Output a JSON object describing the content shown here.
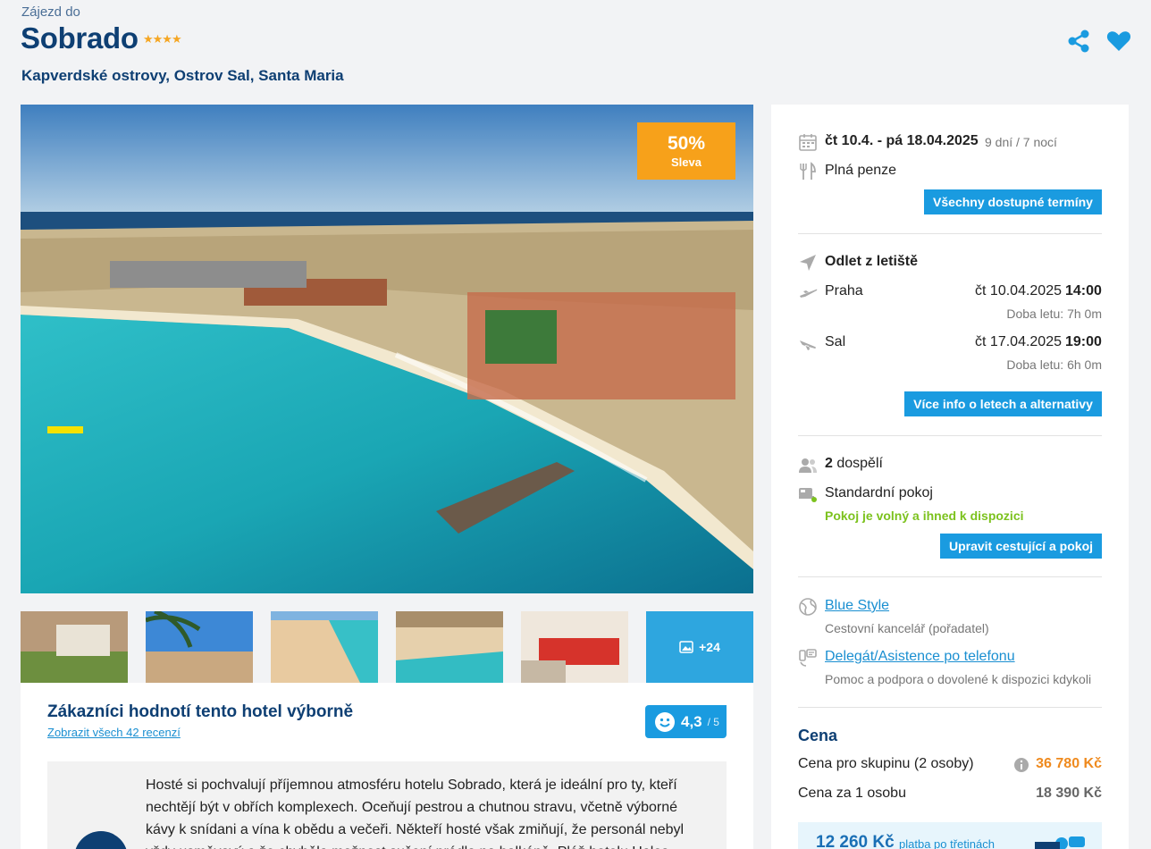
{
  "header": {
    "pre_title": "Zájezd do",
    "hotel_name": "Sobrado",
    "stars": "★★★★",
    "location": "Kapverdské ostrovy, Ostrov Sal, Santa Maria",
    "share_icon": "share-icon",
    "favorite_icon": "heart-icon"
  },
  "gallery": {
    "discount_pct": "50%",
    "discount_label": "Sleva",
    "more_count": "+24"
  },
  "reviews": {
    "title": "Zákazníci hodnotí tento hotel výborně",
    "link": "Zobrazit všech 42 recenzí",
    "rating": "4,3",
    "rating_max": "/ 5",
    "summary": "Hosté si pochvalují příjemnou atmosféru hotelu Sobrado, která je ideální pro ty, kteří nechtějí být v obřích komplexech. Oceňují pestrou a chutnou stravu, včetně výborné kávy k snídani a vína k obědu a večeři. Někteří hosté však zmiňují, že personál nebyl vždy usměvavý a že chyběla možnost sušení prádla na balkóně. Pláž hotelu Halos"
  },
  "trip": {
    "dates": "čt 10.4. - pá 18.04.2025",
    "duration": "9 dní / 7 nocí",
    "board": "Plná penze",
    "all_dates_button": "Všechny dostupné termíny"
  },
  "flights": {
    "title": "Odlet z letiště",
    "outbound": {
      "city": "Praha",
      "date": "čt 10.04.2025",
      "time": "14:00",
      "duration": "Doba letu: 7h 0m"
    },
    "inbound": {
      "city": "Sal",
      "date": "čt 17.04.2025",
      "time": "19:00",
      "duration": "Doba letu: 6h 0m"
    },
    "info_button": "Více info o letech a alternativy"
  },
  "travelers": {
    "count": "2",
    "label": "dospělí",
    "room": "Standardní pokoj",
    "availability": "Pokoj je volný a ihned k dispozici",
    "edit_button": "Upravit cestující a pokoj"
  },
  "organizer": {
    "name": "Blue Style",
    "role": "Cestovní kancelář (pořadatel)",
    "delegate": "Delegát/Asistence po telefonu",
    "delegate_note": "Pomoc a podpora o dovolené k dispozici kdykoli"
  },
  "price": {
    "title": "Cena",
    "group_label": "Cena pro skupinu (2 osoby)",
    "group_value": "36 780 Kč",
    "person_label": "Cena za 1 osobu",
    "person_value": "18 390 Kč",
    "installment_value": "12 260 Kč",
    "installment_text": "platba po třetinách"
  },
  "colors": {
    "brand": "#0e3f73",
    "accent": "#1a9be0",
    "discount": "#f7a11a",
    "available": "#7cc21e",
    "price": "#ef8a1e"
  }
}
